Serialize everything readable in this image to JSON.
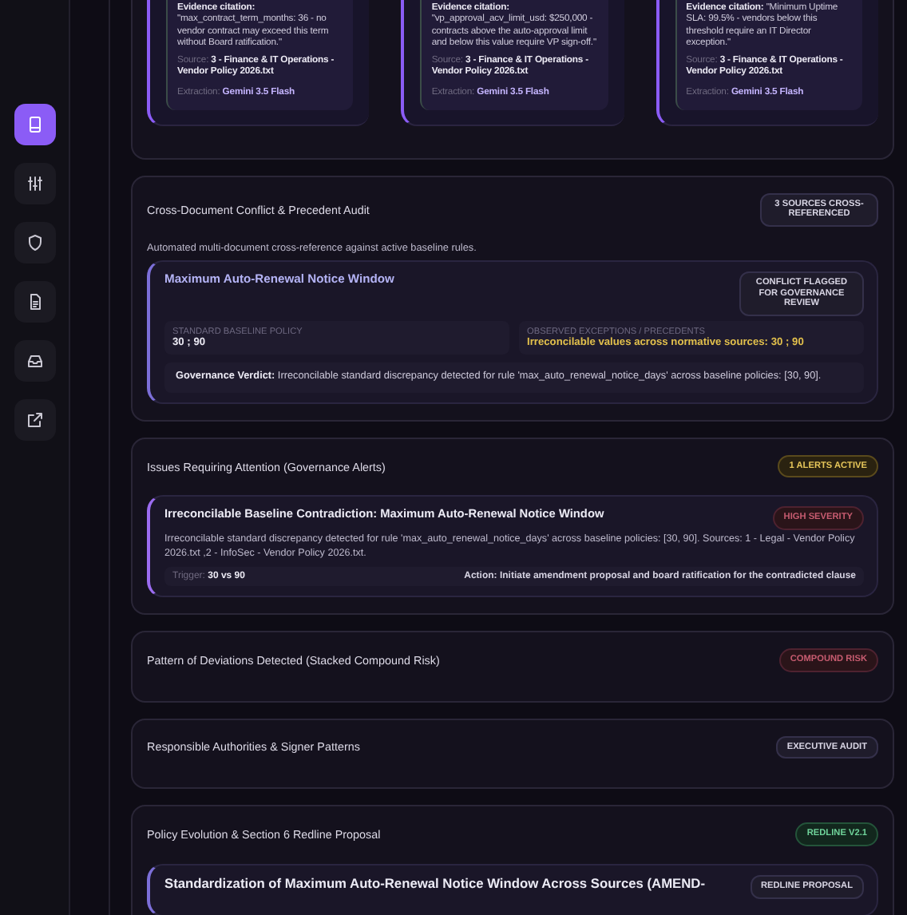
{
  "sidebar": {
    "items": [
      {
        "selected": true
      },
      {
        "selected": false
      },
      {
        "selected": false
      },
      {
        "selected": false
      },
      {
        "selected": false
      },
      {
        "selected": false
      }
    ]
  },
  "evidence_cards": [
    {
      "label": "Evidence citation:",
      "citation": "\"max_contract_term_months: 36 - no vendor contract may exceed this term without Board ratification.\"",
      "source_label": "Source:",
      "source": "3 - Finance & IT Operations - Vendor Policy 2026.txt",
      "extraction_label": "Extraction:",
      "extraction": "Gemini 3.5 Flash"
    },
    {
      "label": "Evidence citation:",
      "citation": "\"vp_approval_acv_limit_usd: $250,000 - contracts above the auto-approval limit and below this value require VP sign-off.\"",
      "source_label": "Source:",
      "source": "3 - Finance & IT Operations - Vendor Policy 2026.txt",
      "extraction_label": "Extraction:",
      "extraction": "Gemini 3.5 Flash"
    },
    {
      "label": "Evidence citation:",
      "citation": "\"Minimum Uptime SLA: 99.5% - vendors below this threshold require an IT Director exception.\"",
      "source_label": "Source:",
      "source": "3 - Finance & IT Operations - Vendor Policy 2026.txt",
      "extraction_label": "Extraction:",
      "extraction": "Gemini 3.5 Flash"
    }
  ],
  "cross_document": {
    "title": "Cross-Document Conflict & Precedent Audit",
    "badge": {
      "text": "3 SOURCES CROSS-REFERENCED",
      "kind": "neutral"
    },
    "description": "Automated multi-document cross-reference against active baseline rules.",
    "conflict": {
      "title": "Maximum Auto-Renewal Notice Window",
      "badge": {
        "text": "CONFLICT FLAGGED FOR GOVERNANCE REVIEW",
        "kind": "neutral"
      },
      "baseline_label": "STANDARD BASELINE POLICY",
      "baseline_value": "30 ; 90",
      "exceptions_label": "OBSERVED EXCEPTIONS / PRECEDENTS",
      "exceptions_value": "Irreconcilable values across normative sources: 30 ; 90",
      "verdict": "**Governance Verdict:** Irreconcilable standard discrepancy detected for rule 'max_auto_renewal_notice_days' across baseline policies: [30, 90]."
    }
  },
  "alerts": {
    "title": "Issues Requiring Attention (Governance Alerts)",
    "badge": {
      "text": "1 ALERTS ACTIVE",
      "kind": "amber"
    },
    "items": [
      {
        "title": "Irreconcilable Baseline Contradiction: Maximum Auto-Renewal Notice Window",
        "badge": {
          "text": "HIGH SEVERITY",
          "kind": "red"
        },
        "description": "Irreconcilable standard discrepancy detected for rule 'max_auto_renewal_notice_days' across baseline policies: [30, 90]. Sources: 1 - Legal - Vendor Policy 2026.txt ,2 - InfoSec - Vendor Policy 2026.txt.",
        "trigger_label": "Trigger:",
        "trigger": "30 vs 90",
        "action": "Action: Initiate amendment proposal and board ratification for the contradicted clause"
      }
    ]
  },
  "patterns": {
    "title": "Pattern of Deviations Detected (Stacked Compound Risk)",
    "badge": {
      "text": "COMPOUND RISK",
      "kind": "red"
    }
  },
  "authorities": {
    "title": "Responsible Authorities & Signer Patterns",
    "badge": {
      "text": "EXECUTIVE AUDIT",
      "kind": "neutral"
    }
  },
  "policy": {
    "title": "Policy Evolution & Section 6 Redline Proposal",
    "badge": {
      "text": "REDLINE V2.1",
      "kind": "green"
    },
    "proposal": {
      "title": "Standardization of Maximum Auto-Renewal Notice Window Across Sources (AMEND-",
      "badge": {
        "text": "REDLINE PROPOSAL",
        "kind": "neutral"
      }
    }
  }
}
